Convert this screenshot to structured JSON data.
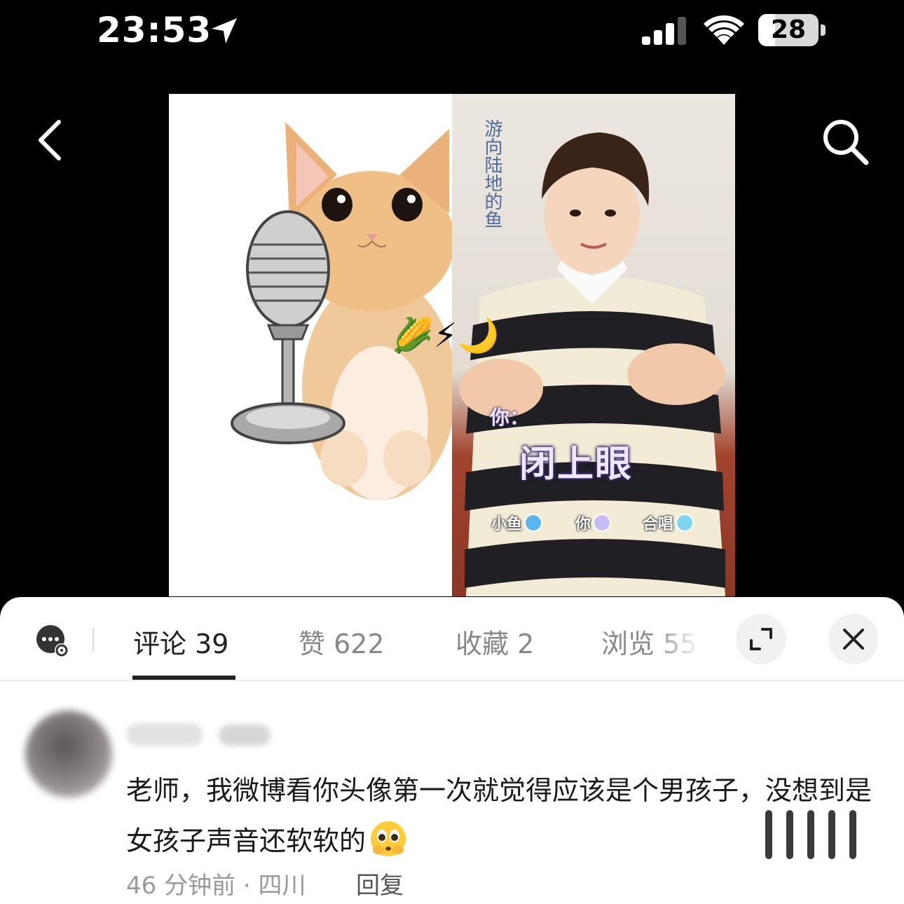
{
  "status_bar": {
    "time": "23:53",
    "battery_level": "28",
    "battery_fraction": 0.28,
    "icons": [
      "location-arrow-icon",
      "cellular-signal-icon",
      "wifi-icon",
      "battery-icon"
    ]
  },
  "header": {
    "back_icon": "chevron-left-icon",
    "search_icon": "search-icon"
  },
  "media": {
    "handwriting": "游向陆地的鱼",
    "emoji_row": "🌽⚡🌙",
    "lyric_speaker": "你：",
    "lyric_main": "闭上眼",
    "legend": [
      {
        "label": "小鱼",
        "color": "#5bb6f0"
      },
      {
        "label": "你",
        "color": "#c8bdf2"
      },
      {
        "label": "合唱",
        "color": "#7fd4ee"
      }
    ]
  },
  "sheet": {
    "tabs": [
      {
        "label": "评论 39",
        "active": true
      },
      {
        "label": "赞 622",
        "active": false
      },
      {
        "label": "收藏 2",
        "active": false
      },
      {
        "label": "浏览 55",
        "active": false
      }
    ],
    "expand_icon": "expand-icon",
    "close_icon": "close-icon",
    "chat_icon": "chat-settings-icon"
  },
  "comments": [
    {
      "text": "老师，我微博看你头像第一次就觉得应该是个男孩子，没想到是女孩子声音还软软的",
      "emoji": "pleading-face-emoji",
      "meta": "46 分钟前 · 四川",
      "reply_label": "回复"
    }
  ],
  "colors": {
    "background": "#000000",
    "sheet": "#ffffff",
    "tab_active": "#222222",
    "tab_inactive": "#888888",
    "meta_text": "#9a9a9a"
  }
}
